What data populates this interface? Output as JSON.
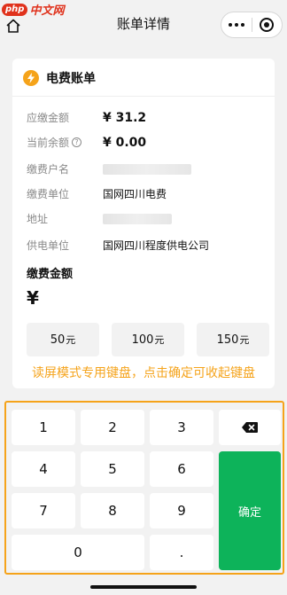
{
  "watermark": {
    "php": "php",
    "cn": "中文网"
  },
  "header": {
    "title": "账单详情"
  },
  "card": {
    "title": "电费账单",
    "rows": [
      {
        "label": "应缴金额",
        "value": "¥ 31.2"
      },
      {
        "label": "当前余额",
        "value": "¥ 0.00"
      },
      {
        "label": "缴费户名",
        "value": ""
      },
      {
        "label": "缴费单位",
        "value": "国网四川电费"
      },
      {
        "label": "地址",
        "value": ""
      },
      {
        "label": "供电单位",
        "value": "国网四川程度供电公司"
      }
    ],
    "amount_heading": "缴费金额",
    "currency_symbol": "¥",
    "presets": [
      {
        "value": "50",
        "unit": "元"
      },
      {
        "value": "100",
        "unit": "元"
      },
      {
        "value": "150",
        "unit": "元"
      }
    ]
  },
  "hint": "读屏模式专用键盘，点击确定可收起键盘",
  "keyboard": {
    "keys": [
      "1",
      "2",
      "3",
      "4",
      "5",
      "6",
      "7",
      "8",
      "9",
      "0",
      "."
    ],
    "confirm_label": "确定"
  },
  "colors": {
    "accent": "#f5a31a",
    "confirm": "#0db35a",
    "brand": "#e0321c"
  }
}
